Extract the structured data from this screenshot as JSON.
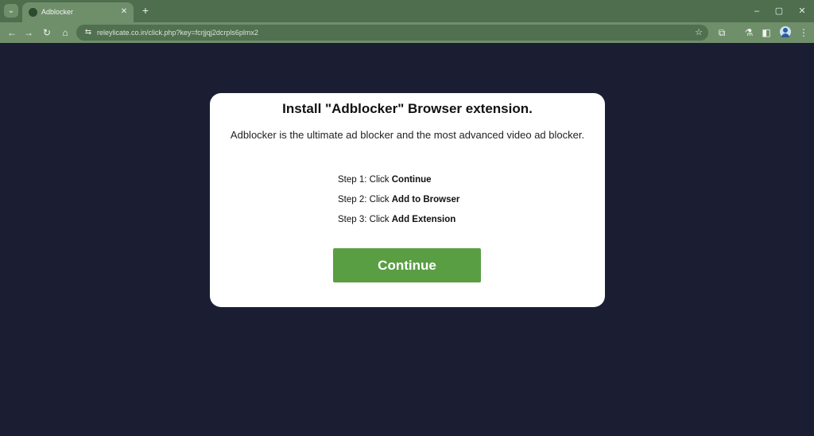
{
  "browser": {
    "tab": {
      "title": "Adblocker",
      "close_glyph": "✕"
    },
    "new_tab_glyph": "+",
    "tab_menu_glyph": "⌄",
    "window_controls": {
      "minimize": "–",
      "maximize": "▢",
      "close": "✕"
    },
    "nav": {
      "back": "←",
      "forward": "→",
      "reload": "↻",
      "home": "⌂"
    },
    "address_bar": {
      "url": "releylicate.co.in/click.php?key=fcrjjqj2dcrpls6plmx2",
      "site_info_glyph": "⇆",
      "bookmark_glyph": "☆"
    },
    "toolbar_icons": {
      "extensions": "⧉",
      "labs": "⚗",
      "side_panel": "◧",
      "menu": "⋮"
    }
  },
  "page": {
    "title": "Install \"Adblocker\" Browser extension.",
    "subtitle": "Adblocker is the ultimate ad blocker and the most advanced video ad blocker.",
    "steps": [
      {
        "prefix": "Step 1: Click ",
        "action": "Continue"
      },
      {
        "prefix": "Step 2: Click ",
        "action": "Add to Browser"
      },
      {
        "prefix": "Step 3: Click ",
        "action": "Add Extension"
      }
    ],
    "continue_label": "Continue"
  },
  "colors": {
    "browser_chrome": "#6f8f6b",
    "page_background": "#1b1d33",
    "card": "#ffffff",
    "button": "#5a9e44"
  }
}
